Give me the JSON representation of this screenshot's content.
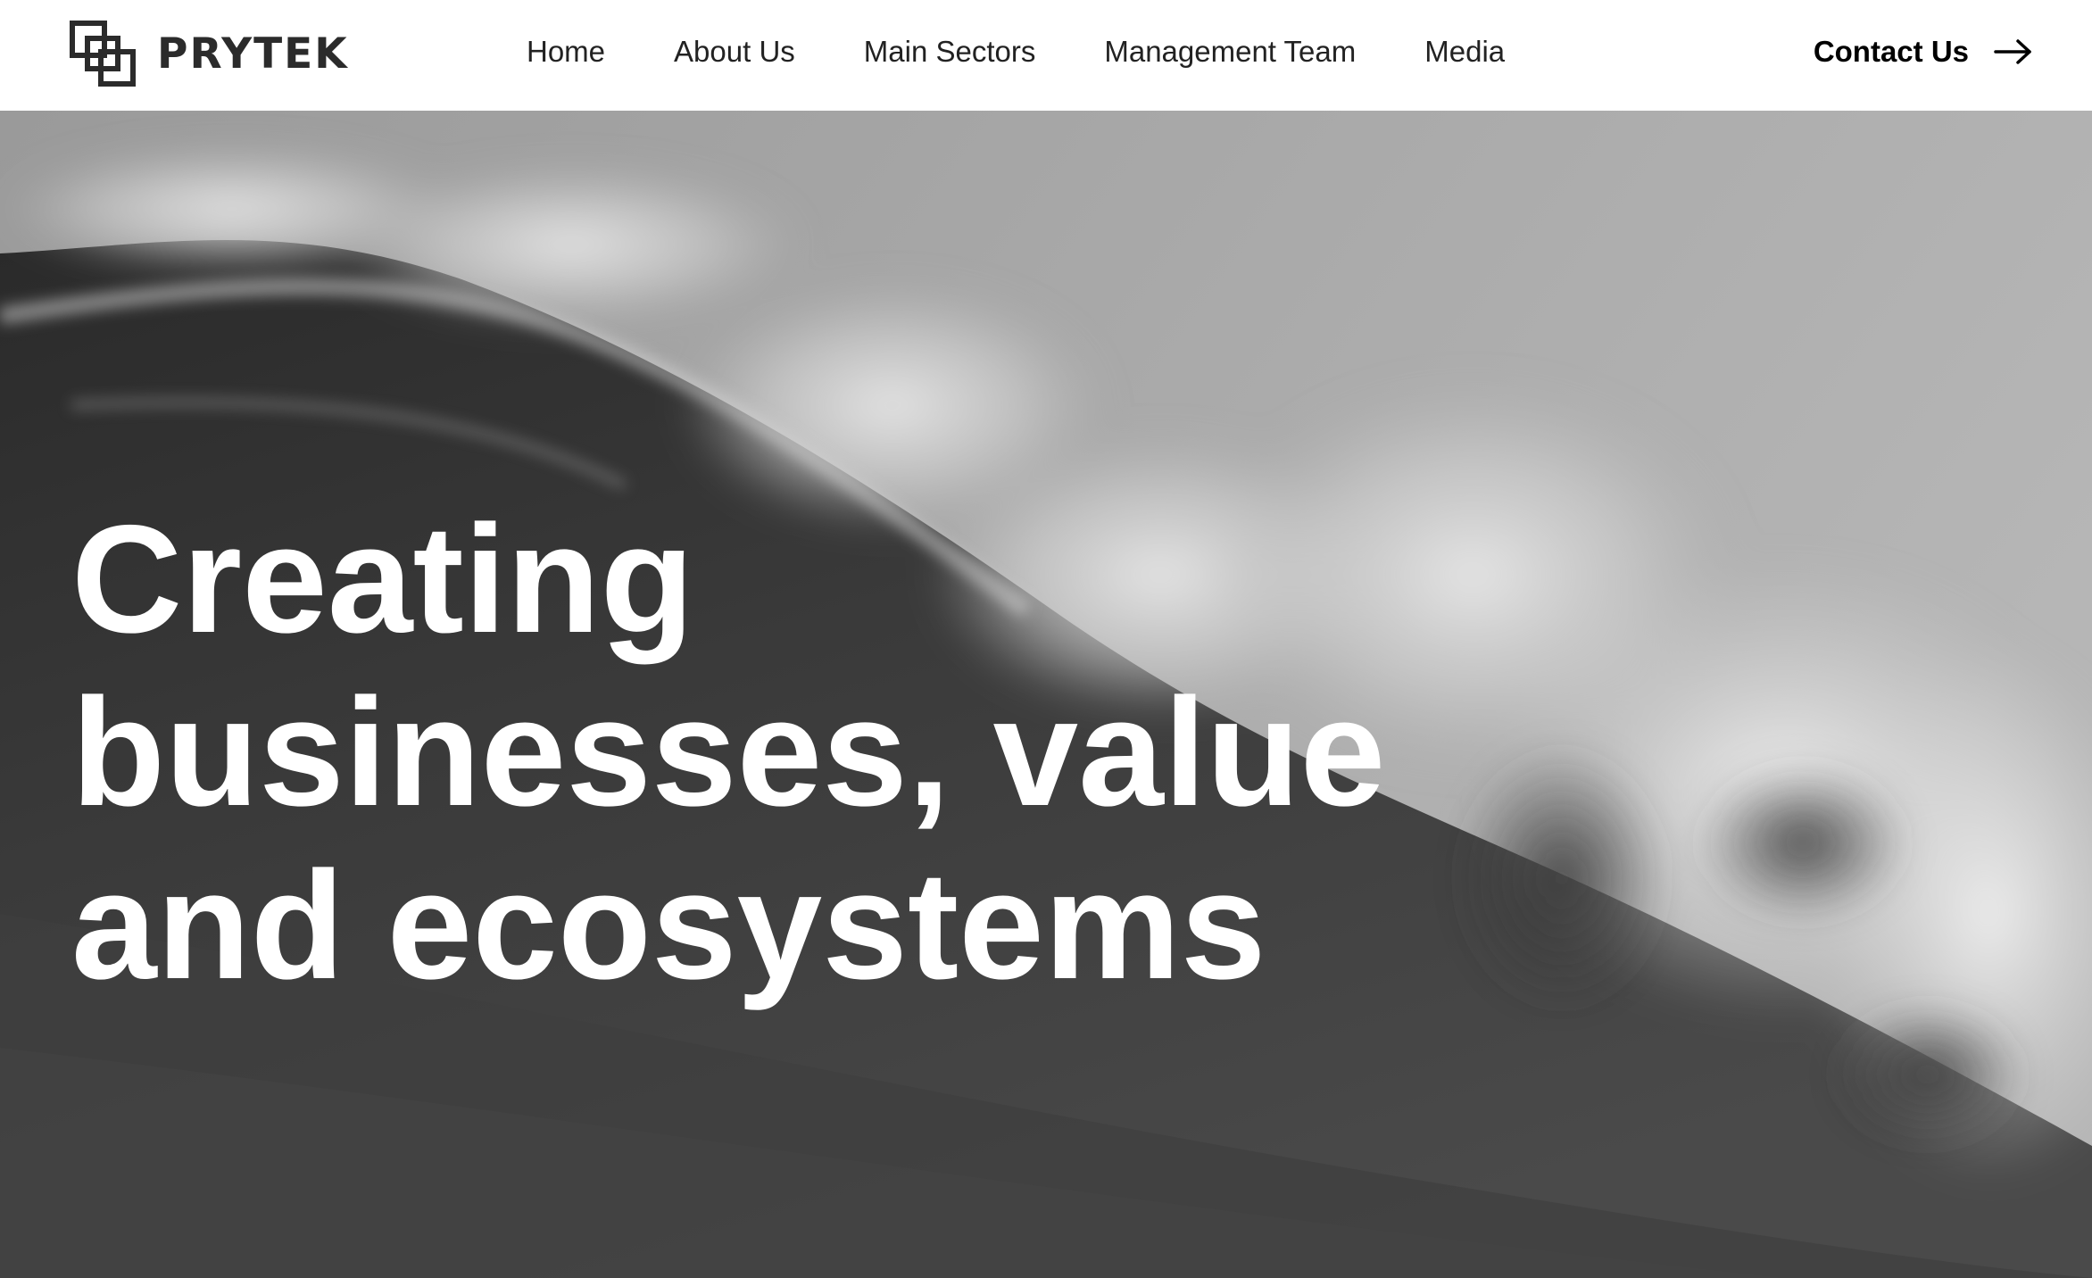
{
  "brand": {
    "name": "PRYTEK",
    "logo_icon": "interlocking-squares-icon"
  },
  "nav": {
    "items": [
      {
        "label": "Home"
      },
      {
        "label": "About Us"
      },
      {
        "label": "Main Sectors"
      },
      {
        "label": "Management Team"
      },
      {
        "label": "Media"
      }
    ]
  },
  "contact": {
    "label": "Contact Us",
    "icon": "arrow-right-icon"
  },
  "hero": {
    "background": "grayscale ocean wave photo",
    "title_lines": [
      "Creating",
      "businesses, value",
      "and ecosystems"
    ]
  },
  "colors": {
    "header_bg": "#ffffff",
    "nav_text": "#222222",
    "logo_text": "#2b2b2b",
    "hero_text": "#ffffff"
  }
}
